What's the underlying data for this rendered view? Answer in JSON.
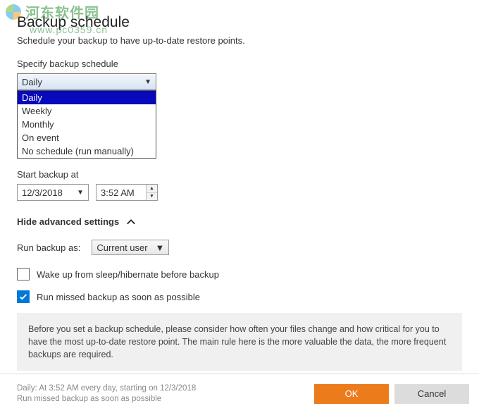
{
  "watermark": {
    "text": "河东软件园",
    "sub": "www.pc0359.cn"
  },
  "header": {
    "title": "Backup schedule",
    "subtitle": "Schedule your backup to have up-to-date restore points."
  },
  "schedule": {
    "label": "Specify backup schedule",
    "selected": "Daily",
    "options": [
      "Daily",
      "Weekly",
      "Monthly",
      "On event",
      "No schedule (run manually)"
    ]
  },
  "start": {
    "label": "Start backup at",
    "date": "12/3/2018",
    "time": "3:52 AM"
  },
  "advanced": {
    "toggle_label": "Hide advanced settings",
    "run_as_label": "Run backup as:",
    "run_as_value": "Current user",
    "wake_label": "Wake up from sleep/hibernate before backup",
    "wake_checked": false,
    "missed_label": "Run missed backup as soon as possible",
    "missed_checked": true,
    "info": "Before you set a backup schedule, please consider how often your files change and how critical for you to have the most up-to-date restore point. The main rule here is the more valuable the data, the more frequent backups are required."
  },
  "footer": {
    "summary_line1": "Daily: At 3:52 AM every day, starting on 12/3/2018",
    "summary_line2": "Run missed backup as soon as possible",
    "ok": "OK",
    "cancel": "Cancel"
  }
}
